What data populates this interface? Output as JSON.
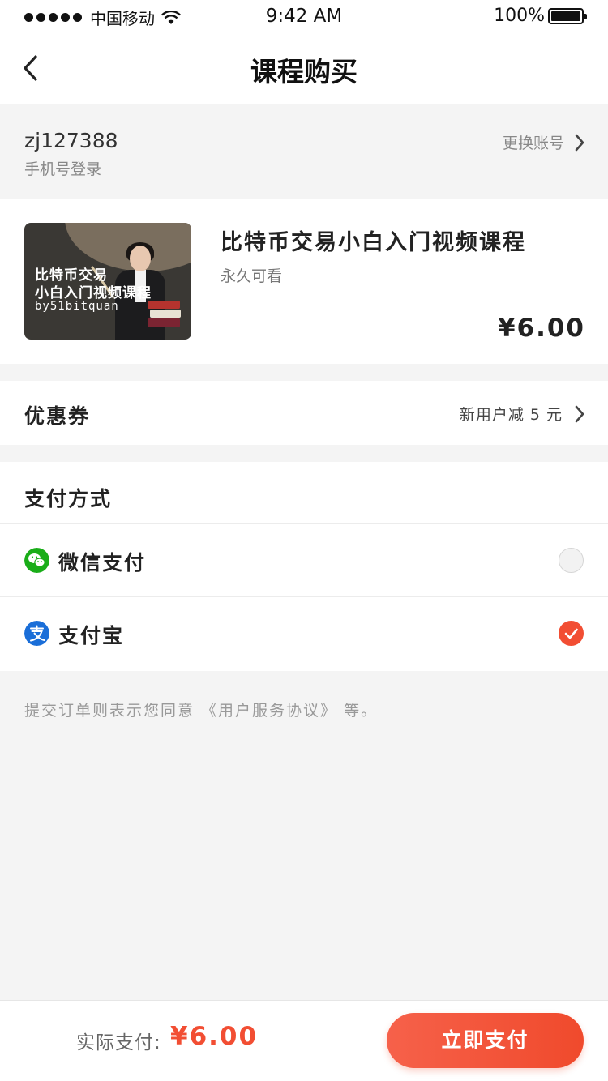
{
  "status_bar": {
    "carrier": "中国移动",
    "time": "9:42 AM",
    "battery": "100%"
  },
  "nav": {
    "title": "课程购买"
  },
  "account": {
    "username": "zj127388",
    "login_type": "手机号登录",
    "switch_label": "更换账号"
  },
  "course": {
    "thumbnail_line1": "比特币交易",
    "thumbnail_line2": "小白入门视频课程",
    "thumbnail_line3": "by51bitquan",
    "title": "比特币交易小白入门视频课程",
    "validity": "永久可看",
    "price": "¥6.00"
  },
  "coupon": {
    "label": "优惠券",
    "value": "新用户减 5 元"
  },
  "payment": {
    "title": "支付方式",
    "methods": [
      {
        "label": "微信支付",
        "icon": "wechat-icon",
        "selected": false,
        "color": "#1aad19"
      },
      {
        "label": "支付宝",
        "icon": "alipay-icon",
        "selected": true,
        "color": "#1a6ed8"
      }
    ]
  },
  "agreement": "提交订单则表示您同意 《用户服务协议》 等。",
  "bottom": {
    "actual_label": "实际支付:",
    "actual_price": "¥6.00",
    "pay_button": "立即支付"
  },
  "colors": {
    "accent": "#f24e33",
    "background": "#f4f4f4"
  }
}
